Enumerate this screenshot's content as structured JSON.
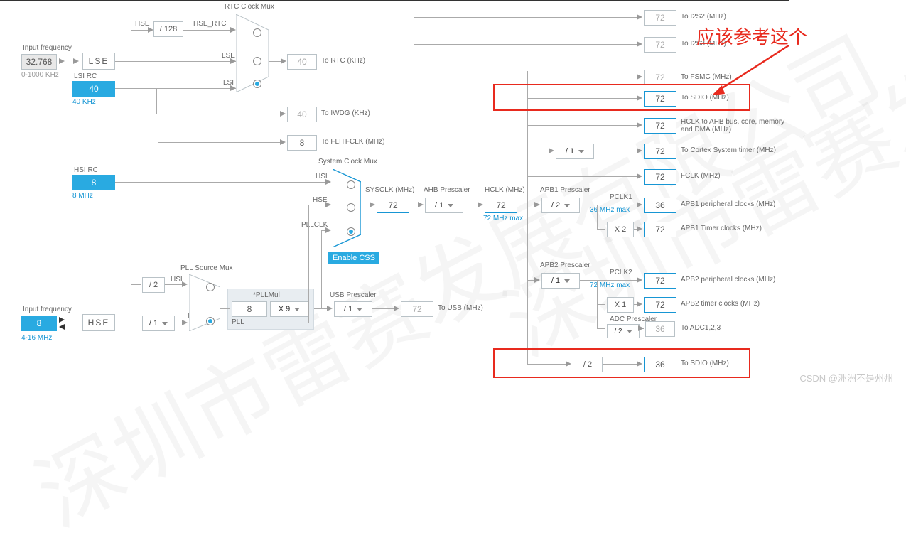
{
  "annotation": {
    "text": "应该参考这个",
    "csdn": "CSDN @洲洲不是州州"
  },
  "watermark": "深圳市雷赛发展有限公司",
  "input_freq_top": {
    "title": "Input frequency",
    "value": "32.768",
    "range": "0-1000 KHz"
  },
  "input_freq_bottom": {
    "title": "Input frequency",
    "value": "8",
    "range": "4-16 MHz"
  },
  "sources": {
    "lse_label": "LSE",
    "lsi_title": "LSI RC",
    "lsi_value": "40",
    "lsi_freq": "40 KHz",
    "hsi_title": "HSI RC",
    "hsi_value": "8",
    "hsi_freq": "8 MHz",
    "hse_label": "HSE"
  },
  "hse_rtc": {
    "div": "/ 128",
    "line_label": "HSE_RTC",
    "src_label": "HSE"
  },
  "rtc_mux": {
    "title": "RTC Clock Mux",
    "inputs": [
      "HSE_RTC",
      "LSE",
      "LSI"
    ],
    "out_value": "40",
    "out_label": "To RTC (KHz)"
  },
  "iwdg": {
    "value": "40",
    "label": "To IWDG (KHz)"
  },
  "flitf": {
    "value": "8",
    "label": "To FLITFCLK (MHz)"
  },
  "pll": {
    "src_title": "PLL Source Mux",
    "hsi_label": "HSI",
    "hsi_div": "/ 2",
    "hse_label": "HSE",
    "hse_div": "/ 1",
    "panel_hdr": "*PLLMul",
    "n_value": "8",
    "mul": "X 9",
    "panel_label": "PLL"
  },
  "usb": {
    "title": "USB Prescaler",
    "div": "/ 1",
    "value": "72",
    "label": "To USB (MHz)"
  },
  "sys_mux": {
    "title": "System Clock Mux",
    "inputs": [
      "HSI",
      "HSE",
      "PLLCLK"
    ],
    "css_label": "Enable CSS"
  },
  "sysclk": {
    "label": "SYSCLK (MHz)",
    "value": "72"
  },
  "ahb": {
    "title": "AHB Prescaler",
    "div": "/ 1",
    "hclk_label": "HCLK (MHz)",
    "hclk_value": "72",
    "hclk_note": "72 MHz max"
  },
  "apb1": {
    "title": "APB1 Prescaler",
    "div": "/ 2",
    "note": "36 MHz max",
    "pclk_label": "PCLK1",
    "periph_value": "36",
    "periph_label": "APB1 peripheral clocks (MHz)",
    "tim_mul": "X 2",
    "tim_value": "72",
    "tim_label": "APB1 Timer clocks (MHz)"
  },
  "apb2": {
    "title": "APB2 Prescaler",
    "div": "/ 1",
    "note": "72 MHz max",
    "pclk_label": "PCLK2",
    "periph_value": "72",
    "periph_label": "APB2 peripheral clocks (MHz)",
    "tim_mul": "X 1",
    "tim_value": "72",
    "tim_label": "APB2 timer clocks (MHz)"
  },
  "adc": {
    "title": "ADC Prescaler",
    "div": "/ 2",
    "value": "36",
    "label": "To ADC1,2,3"
  },
  "cortex": {
    "div": "/ 1",
    "value": "72",
    "label": "To Cortex System timer (MHz)"
  },
  "outputs": {
    "i2s2": {
      "value": "72",
      "label": "To I2S2 (MHz)"
    },
    "i2s3": {
      "value": "72",
      "label": "To I2S3 (MHz)"
    },
    "fsmc": {
      "value": "72",
      "label": "To FSMC (MHz)"
    },
    "sdio1": {
      "value": "72",
      "label": "To SDIO (MHz)"
    },
    "hclk_ahb": {
      "value": "72",
      "label": "HCLK to AHB bus, core, memory and DMA (MHz)"
    },
    "fclk": {
      "value": "72",
      "label": "FCLK (MHz)"
    },
    "sdio2": {
      "div": "/ 2",
      "value": "36",
      "label": "To SDIO (MHz)"
    }
  },
  "chart_data": {
    "type": "block-diagram",
    "description": "STM32 clock tree configuration diagram",
    "nodes": [
      {
        "id": "HSE",
        "freq_MHz": 8
      },
      {
        "id": "HSI",
        "freq_MHz": 8
      },
      {
        "id": "LSE",
        "freq_kHz": 32.768
      },
      {
        "id": "LSI",
        "freq_kHz": 40
      },
      {
        "id": "PLL",
        "in": 8,
        "mul": 9,
        "out_MHz": 72
      },
      {
        "id": "SYSCLK",
        "src": "PLLCLK",
        "freq_MHz": 72
      },
      {
        "id": "AHB",
        "div": 1,
        "HCLK_MHz": 72
      },
      {
        "id": "APB1",
        "div": 2,
        "PCLK1_MHz": 36,
        "tim_mul": 2,
        "tim_MHz": 72
      },
      {
        "id": "APB2",
        "div": 1,
        "PCLK2_MHz": 72,
        "tim_mul": 1,
        "tim_MHz": 72
      },
      {
        "id": "ADC",
        "div": 2,
        "freq_MHz": 36
      },
      {
        "id": "USB",
        "div": 1,
        "freq_MHz": 72
      },
      {
        "id": "RTC",
        "src": "LSI",
        "freq_kHz": 40
      },
      {
        "id": "IWDG",
        "freq_kHz": 40
      },
      {
        "id": "SDIO_top",
        "freq_MHz": 72
      },
      {
        "id": "SDIO_bottom",
        "div": 2,
        "freq_MHz": 36
      }
    ]
  }
}
